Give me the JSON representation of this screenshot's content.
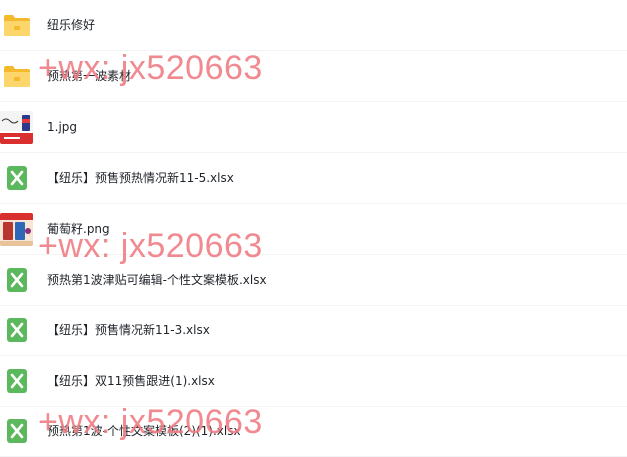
{
  "files": [
    {
      "name": "纽乐修好",
      "type": "folder",
      "icon": "folder-icon"
    },
    {
      "name": "预热第一波素材",
      "type": "folder",
      "icon": "folder-icon"
    },
    {
      "name": "1.jpg",
      "type": "image",
      "icon": "image-thumbnail"
    },
    {
      "name": "【纽乐】预售预热情况新11-5.xlsx",
      "type": "excel",
      "icon": "excel-icon"
    },
    {
      "name": "葡萄籽.png",
      "type": "image",
      "icon": "image-thumbnail"
    },
    {
      "name": "预热第1波津贴可编辑-个性文案模板.xlsx",
      "type": "excel",
      "icon": "excel-icon"
    },
    {
      "name": "【纽乐】预售情况新11-3.xlsx",
      "type": "excel",
      "icon": "excel-icon"
    },
    {
      "name": "【纽乐】双11预售跟进(1).xlsx",
      "type": "excel",
      "icon": "excel-icon"
    },
    {
      "name": "预热第1波-个性文案模板(2)(1).xlsx",
      "type": "excel",
      "icon": "excel-icon"
    }
  ],
  "watermark": {
    "text": "+wx: jx520663"
  },
  "colors": {
    "folder": "#f7c948",
    "excel": "#5cb85c",
    "watermark": "#f07e84"
  }
}
